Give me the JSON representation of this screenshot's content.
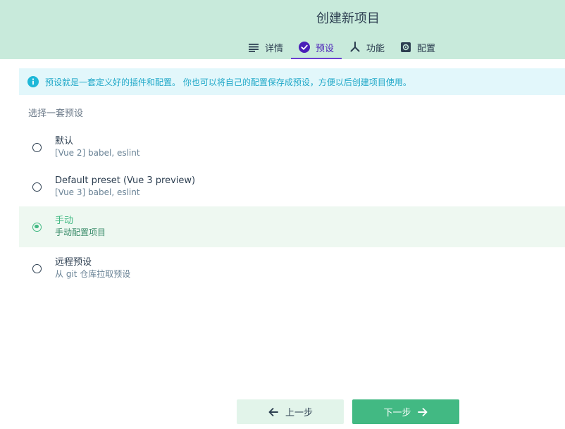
{
  "header": {
    "title": "创建新项目",
    "tabs": [
      {
        "label": "详情",
        "icon": "list-icon"
      },
      {
        "label": "预设",
        "icon": "check-circle-icon",
        "active": true
      },
      {
        "label": "功能",
        "icon": "fork-icon"
      },
      {
        "label": "配置",
        "icon": "settings-icon"
      }
    ]
  },
  "info": {
    "text": "预设就是一套定义好的插件和配置。 你也可以将自己的配置保存成预设，方便以后创建项目使用。",
    "icon": "info-icon"
  },
  "presets": {
    "label": "选择一套预设",
    "options": [
      {
        "name": "默认",
        "desc": "[Vue 2] babel, eslint",
        "selected": false
      },
      {
        "name": "Default preset (Vue 3 preview)",
        "desc": "[Vue 3] babel, eslint",
        "selected": false
      },
      {
        "name": "手动",
        "desc": "手动配置项目",
        "selected": true
      },
      {
        "name": "远程预设",
        "desc": "从 git 仓库拉取预设",
        "selected": false
      }
    ]
  },
  "footer": {
    "prev_label": "上一步",
    "next_label": "下一步"
  },
  "colors": {
    "header_bg": "#c8eadb",
    "accent": "#42b983",
    "active_tab": "#4a1fb8",
    "info_text": "#1fa8c8"
  }
}
